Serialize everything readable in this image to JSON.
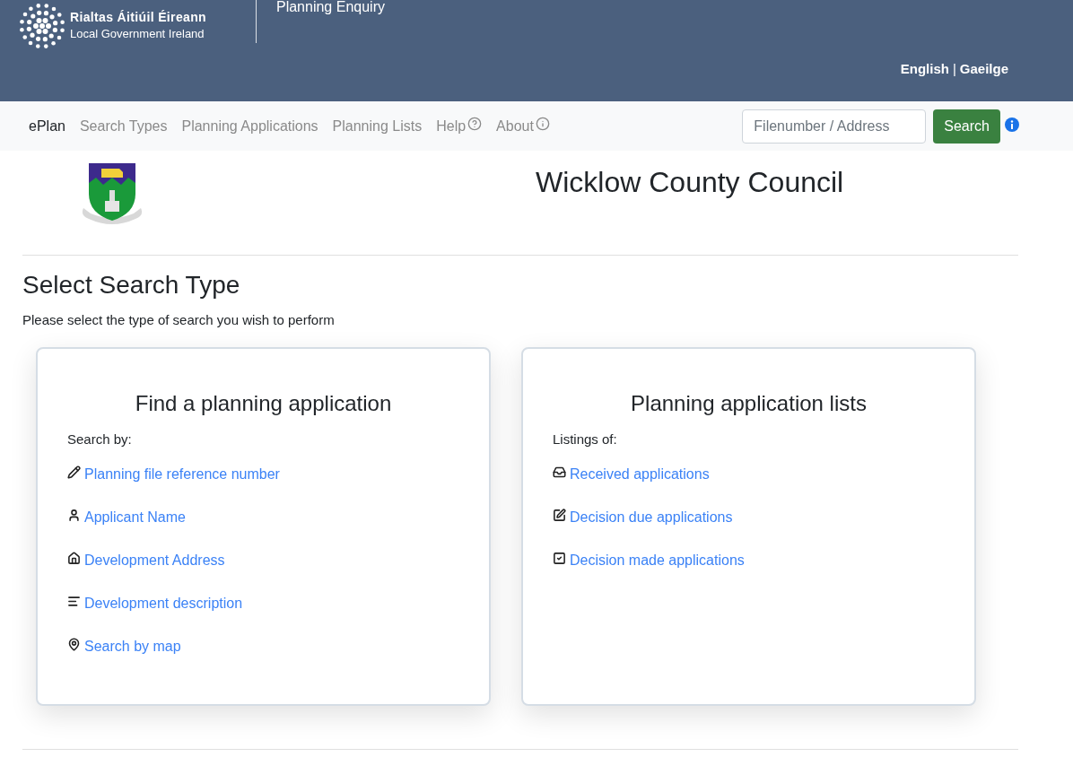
{
  "header": {
    "logo_line_1": "Rialtas Áitiúil Éireann",
    "logo_line_2": "Local Government Ireland",
    "app_title": "Planning Enquiry",
    "languages": [
      {
        "label": "English"
      },
      {
        "label": "Gaeilge"
      }
    ],
    "language_separator": "|"
  },
  "nav": {
    "items": [
      {
        "label": "ePlan",
        "selected": true,
        "kind": "plain"
      },
      {
        "label": "Search Types",
        "selected": false,
        "kind": "plain"
      },
      {
        "label": "Planning Applications",
        "selected": false,
        "kind": "plain"
      },
      {
        "label": "Planning Lists",
        "selected": false,
        "kind": "plain"
      },
      {
        "label": "Help",
        "selected": false,
        "kind": "help"
      },
      {
        "label": "About",
        "selected": false,
        "kind": "info"
      }
    ],
    "search": {
      "placeholder": "Filenumber / Address",
      "button": "Search"
    }
  },
  "council": {
    "name": "Wicklow County Council"
  },
  "page": {
    "title": "Select Search Type",
    "intro": "Please select the type of search you wish to perform"
  },
  "cards": [
    {
      "title": "Find a planning application",
      "subtitle": "Search by:",
      "links": [
        {
          "label": "Planning file reference number",
          "kind": "pencil"
        },
        {
          "label": "Applicant Name",
          "kind": "user"
        },
        {
          "label": "Development Address",
          "kind": "home"
        },
        {
          "label": "Development description",
          "kind": "lines"
        },
        {
          "label": "Search by map",
          "kind": "pin"
        }
      ]
    },
    {
      "title": "Planning application lists",
      "subtitle": "Listings of:",
      "links": [
        {
          "label": "Received applications",
          "kind": "inbox"
        },
        {
          "label": "Decision due applications",
          "kind": "edit"
        },
        {
          "label": "Decision made applications",
          "kind": "check"
        }
      ]
    }
  ]
}
